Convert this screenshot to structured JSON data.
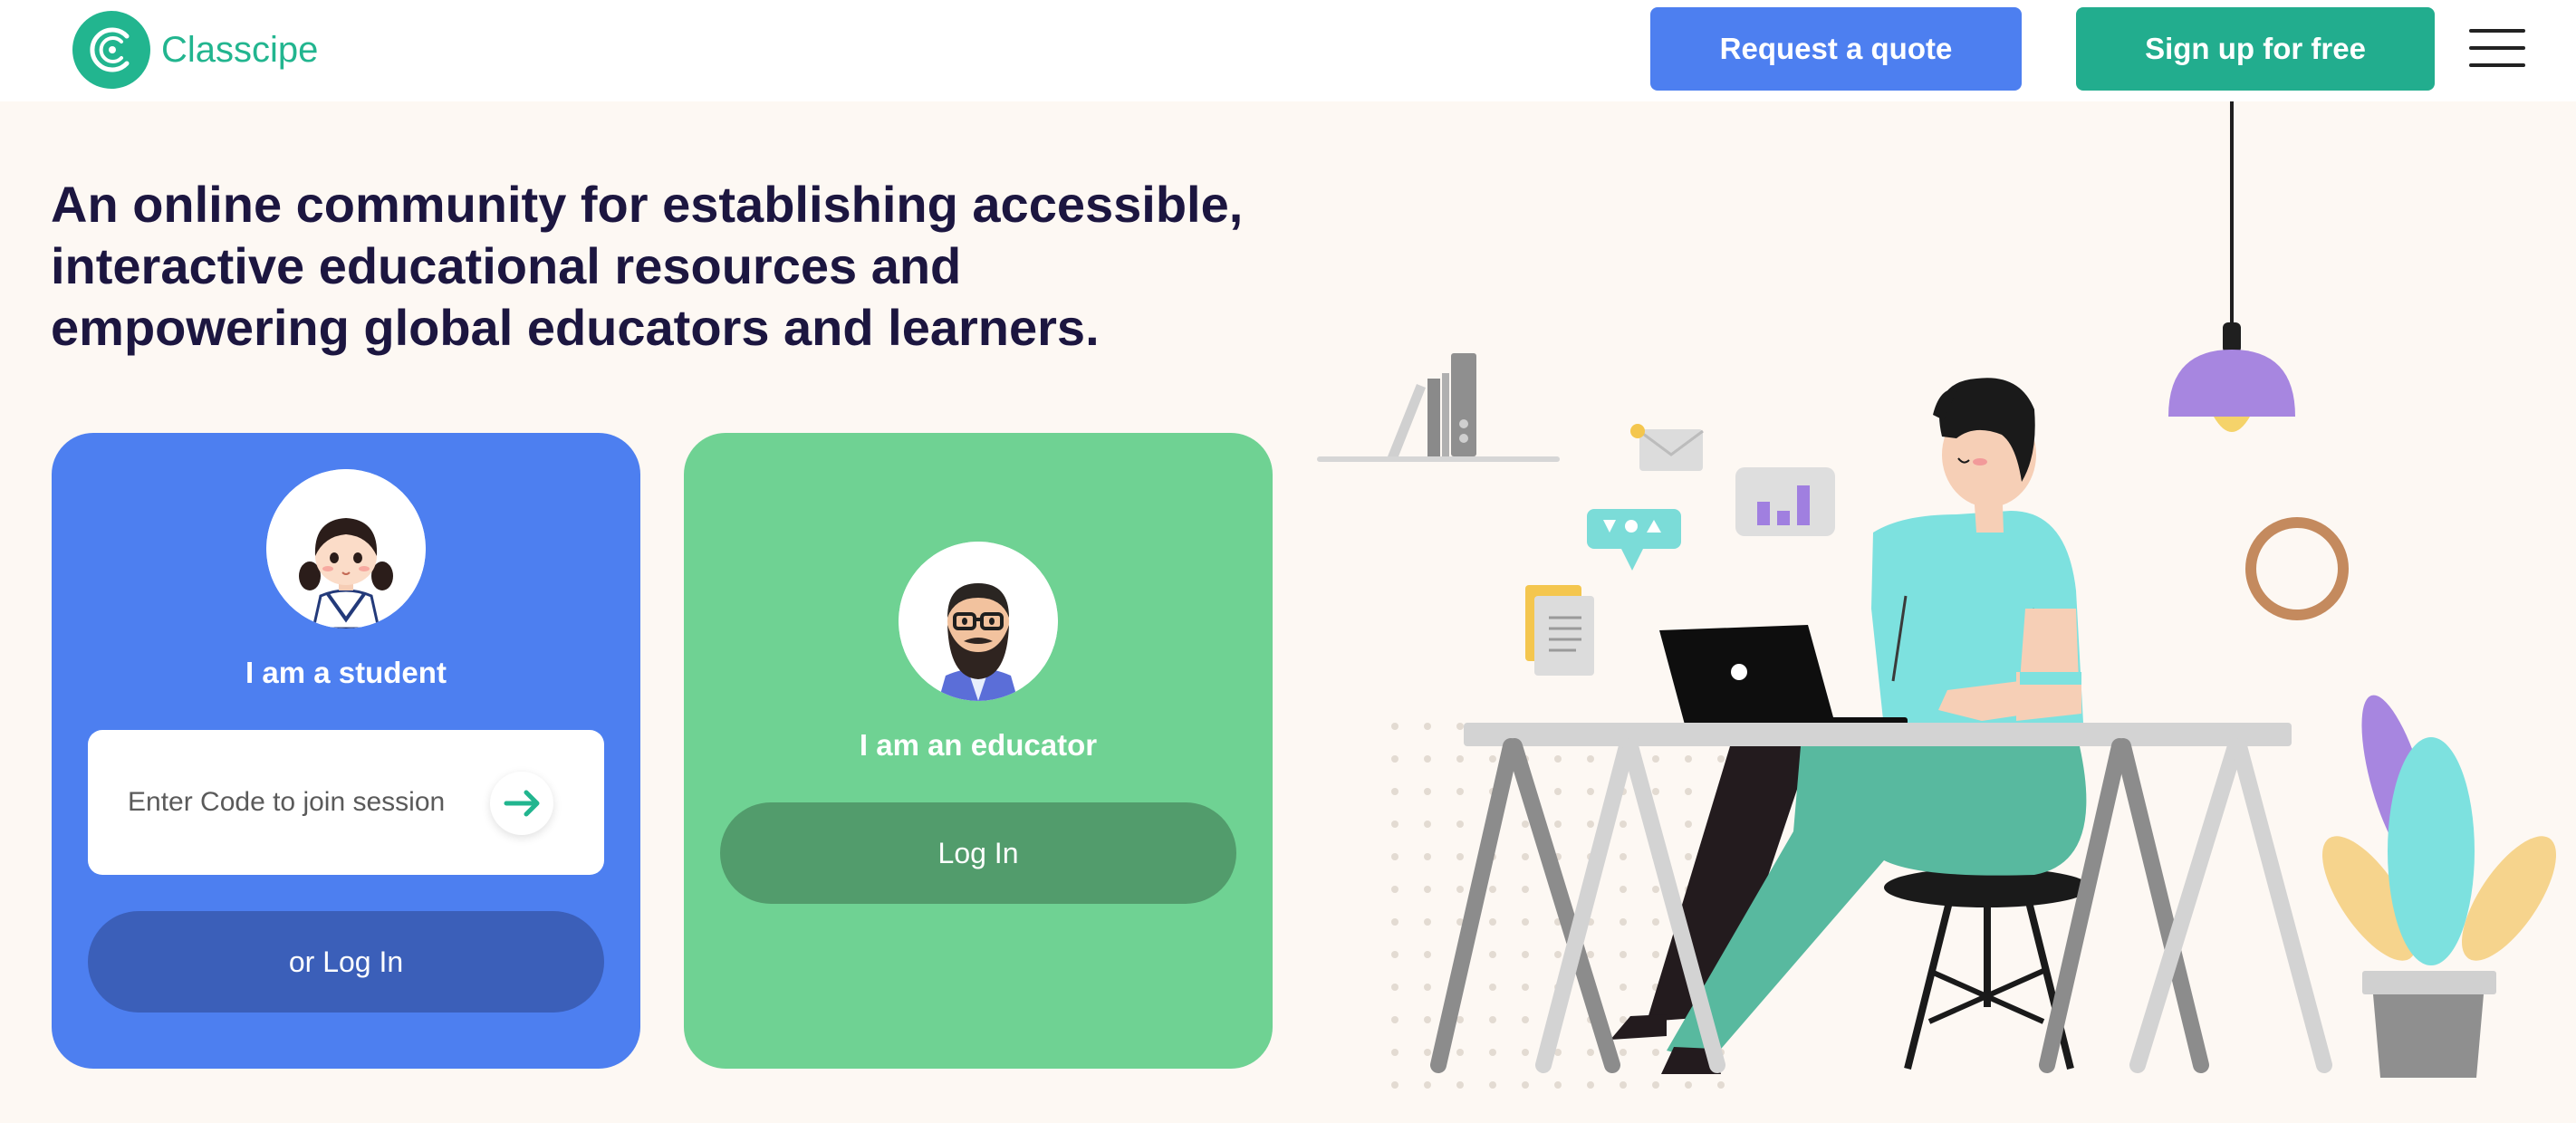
{
  "header": {
    "brand": "Classcipe",
    "request_quote_label": "Request a quote",
    "signup_label": "Sign up for free"
  },
  "hero": {
    "headline_line1": "An online community for establishing accessible,",
    "headline_line2": "interactive educational resources and",
    "headline_line3": "empowering global educators and learners."
  },
  "student_card": {
    "title": "I am a student",
    "code_placeholder": "Enter Code to join session",
    "login_label": "or Log In"
  },
  "educator_card": {
    "title": "I am an educator",
    "login_label": "Log In"
  },
  "colors": {
    "brand_green": "#22b58f",
    "primary_blue": "#4d7ff0",
    "educator_green": "#6fd293",
    "background": "#fdf8f3"
  }
}
